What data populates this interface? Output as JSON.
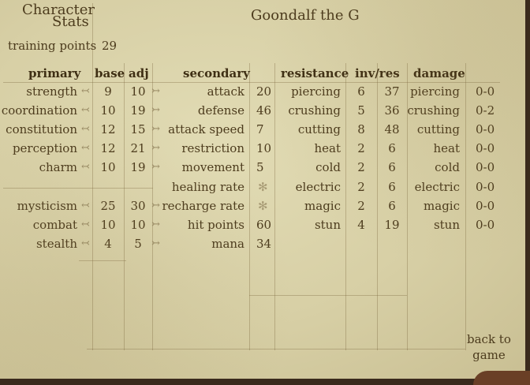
{
  "title": {
    "line1": "Character",
    "line2": "Stats"
  },
  "character_name": "Goondalf the G",
  "training_points": {
    "label": "training points",
    "value": "29"
  },
  "headers": {
    "primary": "primary",
    "base": "base",
    "adj": "adj",
    "secondary": "secondary",
    "resistance": "resistance",
    "inv_res": "inv/res",
    "damage": "damage"
  },
  "primary_stats": [
    {
      "name": "strength",
      "base": "9",
      "adj": "10"
    },
    {
      "name": "coordination",
      "base": "10",
      "adj": "19"
    },
    {
      "name": "constitution",
      "base": "12",
      "adj": "15"
    },
    {
      "name": "perception",
      "base": "12",
      "adj": "21"
    },
    {
      "name": "charm",
      "base": "10",
      "adj": "19"
    }
  ],
  "skill_stats": [
    {
      "name": "mysticism",
      "base": "25",
      "adj": "30"
    },
    {
      "name": "combat",
      "base": "10",
      "adj": "10"
    },
    {
      "name": "stealth",
      "base": "4",
      "adj": "5"
    }
  ],
  "secondary_stats": [
    {
      "name": "attack",
      "value": "20"
    },
    {
      "name": "defense",
      "value": "46"
    },
    {
      "name": "attack speed",
      "value": "7"
    },
    {
      "name": "restriction",
      "value": "10"
    },
    {
      "name": "movement",
      "value": "5"
    },
    {
      "name": "healing rate",
      "value": "✻"
    },
    {
      "name": "recharge rate",
      "value": "✻"
    },
    {
      "name": "hit points",
      "value": "60"
    },
    {
      "name": "mana",
      "value": "34"
    }
  ],
  "resistances": [
    {
      "name": "piercing",
      "inv": "6",
      "res": "37"
    },
    {
      "name": "crushing",
      "inv": "5",
      "res": "36"
    },
    {
      "name": "cutting",
      "inv": "8",
      "res": "48"
    },
    {
      "name": "heat",
      "inv": "2",
      "res": "6"
    },
    {
      "name": "cold",
      "inv": "2",
      "res": "6"
    },
    {
      "name": "electric",
      "inv": "2",
      "res": "6"
    },
    {
      "name": "magic",
      "inv": "2",
      "res": "6"
    },
    {
      "name": "stun",
      "inv": "4",
      "res": "19"
    }
  ],
  "damage": [
    {
      "name": "piercing",
      "value": "0-0"
    },
    {
      "name": "crushing",
      "value": "0-2"
    },
    {
      "name": "cutting",
      "value": "0-0"
    },
    {
      "name": "heat",
      "value": "0-0"
    },
    {
      "name": "cold",
      "value": "0-0"
    },
    {
      "name": "electric",
      "value": "0-0"
    },
    {
      "name": "magic",
      "value": "0-0"
    },
    {
      "name": "stun",
      "value": "0-0"
    }
  ],
  "back_button": {
    "line1": "back to",
    "line2": "game"
  },
  "icons": {
    "decrease": "arrow-left-icon",
    "increase": "arrow-right-icon"
  }
}
